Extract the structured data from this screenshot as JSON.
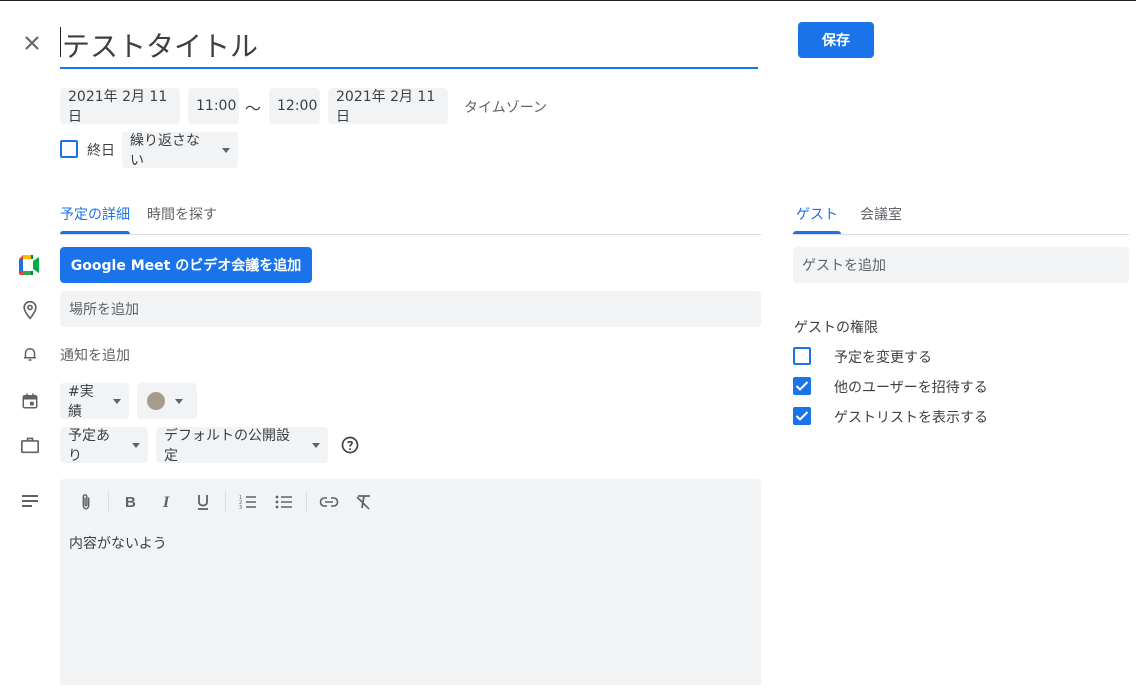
{
  "header": {
    "title": "テストタイトル",
    "save_label": "保存"
  },
  "datetime": {
    "start_date": "2021年 2月 11日",
    "start_time": "11:00",
    "separator": "～",
    "end_time": "12:00",
    "end_date": "2021年 2月 11日",
    "timezone_label": "タイムゾーン",
    "allday_label": "終日",
    "recurrence": "繰り返さない"
  },
  "tabs_left": [
    {
      "label": "予定の詳細",
      "active": true
    },
    {
      "label": "時間を探す",
      "active": false
    }
  ],
  "details": {
    "meet_button": "Google Meet のビデオ会議を追加",
    "location_placeholder": "場所を追加",
    "notification_label": "通知を追加",
    "calendar_name": "#実績",
    "event_color": "#a79b8e",
    "availability": "予定あり",
    "visibility": "デフォルトの公開設定",
    "description": "内容がないよう"
  },
  "tabs_right": [
    {
      "label": "ゲスト",
      "active": true
    },
    {
      "label": "会議室",
      "active": false
    }
  ],
  "guests": {
    "add_placeholder": "ゲストを追加",
    "permissions_title": "ゲストの権限",
    "permissions": [
      {
        "label": "予定を変更する",
        "checked": false
      },
      {
        "label": "他のユーザーを招待する",
        "checked": true
      },
      {
        "label": "ゲストリストを表示する",
        "checked": true
      }
    ]
  },
  "colors": {
    "accent": "#1a73e8",
    "field_bg": "#f1f3f4"
  }
}
